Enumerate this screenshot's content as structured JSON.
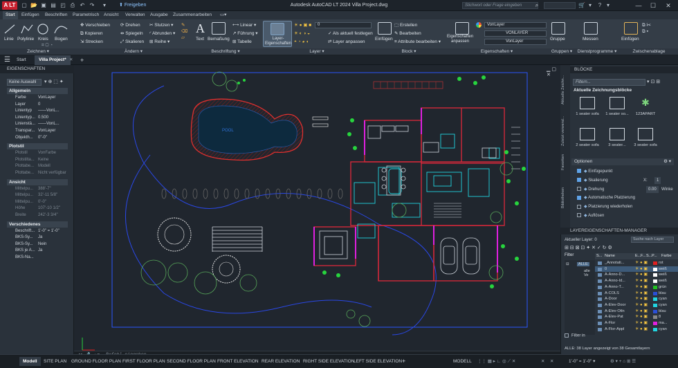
{
  "app": {
    "title": "Autodesk AutoCAD LT 2024   Villa Project.dwg",
    "logo": "A LT",
    "share": "Freigeben",
    "search_placeholder": "Stichwort oder Frage eingeben",
    "window_controls": [
      "—",
      "☐",
      "✕"
    ]
  },
  "ribbon_tabs": [
    {
      "label": "Start",
      "active": true
    },
    {
      "label": "Einfügen"
    },
    {
      "label": "Beschriften"
    },
    {
      "label": "Parametrisch"
    },
    {
      "label": "Ansicht"
    },
    {
      "label": "Verwalten"
    },
    {
      "label": "Ausgabe"
    },
    {
      "label": "Zusammenarbeiten"
    },
    {
      "label": "▭▾"
    }
  ],
  "ribbon": {
    "draw": {
      "title": "Zeichnen ▾",
      "tools": [
        "Linie",
        "Polylinie",
        "Kreis",
        "Bogen"
      ]
    },
    "modify": {
      "title": "Ändern ▾",
      "items": [
        "Verschieben",
        "Drehen",
        "Stutzen ▾",
        "Kopieren",
        "Spiegeln",
        "Abrunden ▾",
        "Strecken",
        "Skalieren",
        "Reihe ▾"
      ]
    },
    "annotation": {
      "title": "Beschriftung ▾",
      "text": "Text",
      "dim": "Bemaßung",
      "items": [
        "Linear ▾",
        "Führung ▾",
        "Tabelle"
      ]
    },
    "layers": {
      "title": "Layer ▾",
      "props": "Layer-\nEigenschaften",
      "layer_value": "0",
      "items": [
        "Als aktuell festlegen",
        "Layer anpassen"
      ]
    },
    "block": {
      "title": "Block ▾",
      "insert": "Einfügen",
      "items": [
        "Erstellen",
        "Bearbeiten",
        "Attribute bearbeiten ▾"
      ]
    },
    "properties": {
      "title": "Eigenschaften ▾",
      "match": "Eigenschaften\nanpassen",
      "values": [
        "VonLayer",
        "VONLAYER",
        "VonLayer"
      ]
    },
    "groups": {
      "title": "Gruppen ▾",
      "label": "Gruppe"
    },
    "utilities": {
      "title": "Dienstprogramme ▾",
      "label": "Messen"
    },
    "clipboard": {
      "title": "Zwischenablage",
      "label": "Einfügen"
    }
  },
  "doc_tabs": [
    {
      "label": "Start"
    },
    {
      "label": "Villa Project*",
      "active": true
    },
    {
      "label": "+"
    }
  ],
  "properties_palette": {
    "header": "EIGENSCHAFTEN",
    "selection": "Keine Auswahl",
    "sections": [
      {
        "title": "Allgemein",
        "rows": [
          [
            "Farbe",
            "VonLayer"
          ],
          [
            "Layer",
            "0"
          ],
          [
            "Linientyp",
            "——VonL..."
          ],
          [
            "Linientyp...",
            "0.500"
          ],
          [
            "Linienstä...",
            "——VonL..."
          ],
          [
            "Transpar...",
            "VonLayer"
          ],
          [
            "Objekth...",
            "0\"-0\""
          ]
        ]
      },
      {
        "title": "Plotstil",
        "rows": [
          [
            "Plotstil",
            "VonFarbe"
          ],
          [
            "Plotstilta...",
            "Keine"
          ],
          [
            "Plottabe...",
            "Modell"
          ],
          [
            "Plottabe...",
            "Nicht verfügbar"
          ]
        ]
      },
      {
        "title": "Ansicht",
        "rows": [
          [
            "Mittelpu...",
            "388'-7\""
          ],
          [
            "Mittelpu...",
            "32'-11 5/8\""
          ],
          [
            "Mittelpu...",
            "0'-0\""
          ],
          [
            "Höhe",
            "107'-10 1/2\""
          ],
          [
            "Breite",
            "242'-3 3/4\""
          ]
        ]
      },
      {
        "title": "Verschiedenes",
        "rows": [
          [
            "Beschrift...",
            "1'-0\" = 1'-0\""
          ],
          [
            "BKS-Sy...",
            "Ja"
          ],
          [
            "BKS-Sy...",
            "Nein"
          ],
          [
            "BKS je A...",
            "Ja"
          ],
          [
            "BKS-Na...",
            ""
          ]
        ]
      }
    ]
  },
  "drawing": {
    "pool_label": "POOL"
  },
  "command": {
    "placeholder": "Befehl eingeben"
  },
  "layout_tabs": [
    {
      "label": "Modell",
      "active": true
    },
    {
      "label": "SITE PLAN"
    },
    {
      "label": "GROUND FLOOR PLAN"
    },
    {
      "label": "FIRST FLOOR PLAN"
    },
    {
      "label": "SECOND FLOOR PLAN"
    },
    {
      "label": "FRONT ELEVATION"
    },
    {
      "label": "REAR ELEVATION"
    },
    {
      "label": "RIGHT SIDE ELEVATION"
    },
    {
      "label": "LEFT SIDE ELEVATION"
    },
    {
      "label": "+"
    }
  ],
  "status": {
    "model": "MODELL",
    "scale": "1'-0\" = 1'-0\" ▾"
  },
  "blocks_palette": {
    "header": "BLÖCKE",
    "filter_placeholder": "Filtern...",
    "side_tabs": [
      "Aktuelle Zeichn...",
      "Zuletzt verwend...",
      "Favoriten",
      "Bibliotheken"
    ],
    "section": "Aktuelle Zeichnungsblöcke",
    "items": [
      "1 seater sofa",
      "1 seater so...",
      "123APART",
      "2 seater sofa",
      "3 seater...",
      "3 seater sofa"
    ],
    "options_title": "Optionen",
    "options": [
      {
        "label": "Einfügepunkt",
        "on": true
      },
      {
        "label": "Skalierung",
        "on": true,
        "x_label": "X:",
        "value": "1"
      },
      {
        "label": "Drehung",
        "on": false,
        "value": "0.00",
        "suffix": "Winke"
      },
      {
        "label": "Automatische Platzierung",
        "on": true
      },
      {
        "label": "Platzierung wiederholen",
        "on": false
      },
      {
        "label": "Auflösen",
        "on": false
      }
    ]
  },
  "layer_manager": {
    "header": "LAYEREIGENSCHAFTEN-MANAGER",
    "current": "Aktueller Layer: 0",
    "search_placeholder": "Suche nach Layer",
    "filter_label": "Filter",
    "tree": [
      "ALLE",
      "alle Ve"
    ],
    "cols": [
      "S...",
      "Name",
      "E...",
      "F...",
      "S...",
      "P...",
      "Farbe"
    ],
    "layers": [
      {
        "name": "_Annotati...",
        "color": "#e02020",
        "cname": "rot"
      },
      {
        "name": "0",
        "color": "#ffffff",
        "cname": "weiß"
      },
      {
        "name": "A-Anno-D...",
        "color": "#ffffff",
        "cname": "weiß"
      },
      {
        "name": "A-Anno-Id...",
        "color": "#ffffff",
        "cname": "weiß"
      },
      {
        "name": "A-Anno-T...",
        "color": "#22c022",
        "cname": "grün"
      },
      {
        "name": "A-COLS",
        "color": "#2a4fd6",
        "cname": "blau"
      },
      {
        "name": "A-Door",
        "color": "#21d5e0",
        "cname": "cyan"
      },
      {
        "name": "A-Elev-Door",
        "color": "#21d5e0",
        "cname": "cyan"
      },
      {
        "name": "A-Elev-Otln",
        "color": "#2a4fd6",
        "cname": "blau"
      },
      {
        "name": "A-Elev-Pat",
        "color": "#888888",
        "cname": "8"
      },
      {
        "name": "A-Flor",
        "color": "#e020e0",
        "cname": "ma..."
      },
      {
        "name": "A-Flor-Appl",
        "color": "#21d5e0",
        "cname": "cyan"
      }
    ],
    "invert_filter": "Filter in",
    "footer": "ALLE: 38 Layer angezeigt von 38 Gesamtlayern"
  }
}
